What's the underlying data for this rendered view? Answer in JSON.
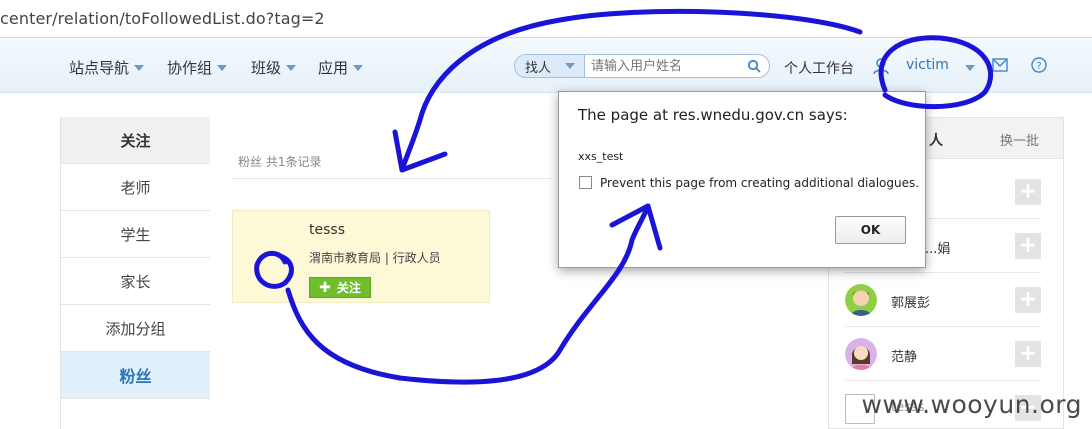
{
  "address_bar": {
    "url": "center/relation/toFollowedList.do?tag=2"
  },
  "nav": {
    "menus": [
      "站点导航",
      "协作组",
      "班级",
      "应用"
    ],
    "search_type": "找人",
    "search_placeholder": "请输入用户姓名",
    "workbench": "个人工作台",
    "username": "victim"
  },
  "sidebar": {
    "items": [
      "关注",
      "老师",
      "学生",
      "家长",
      "添加分组",
      "粉丝"
    ],
    "active": "粉丝"
  },
  "main": {
    "summary": "粉丝 共1条记录",
    "card": {
      "name": "tesss",
      "org": "渭南市教育局 | 行政人员",
      "follow_label": "关注"
    }
  },
  "right_panel": {
    "title": "人",
    "refresh": "换一批",
    "people": [
      {
        "name": ""
      },
      {
        "name": "...娟"
      },
      {
        "name": "郭展彭"
      },
      {
        "name": "范静"
      },
      {
        "name": "tesss"
      }
    ]
  },
  "dialog": {
    "title": "The page at res.wnedu.gov.cn says:",
    "message": "xxs_test",
    "checkbox_label": "Prevent this page from creating additional dialogues.",
    "ok_label": "OK"
  },
  "watermark": "www.wooyun.org",
  "colors": {
    "accent": "#2c76b8",
    "follow_green": "#6fbe2c",
    "card_bg": "#fdf8d6",
    "scribble": "#1a14d8"
  }
}
